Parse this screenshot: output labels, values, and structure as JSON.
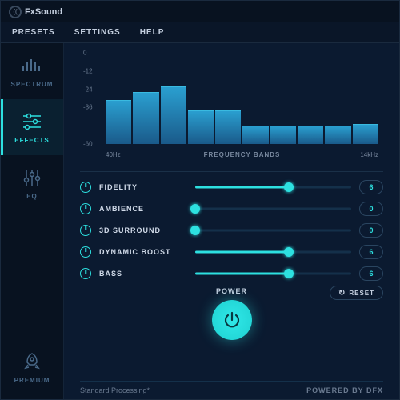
{
  "app": {
    "name": "FxSound",
    "logo_glyph": "(("
  },
  "menu": {
    "presets": "PRESETS",
    "settings": "SETTINGS",
    "help": "HELP"
  },
  "sidebar": {
    "items": [
      {
        "id": "spectrum",
        "label": "SPECTRUM"
      },
      {
        "id": "effects",
        "label": "EFFECTS"
      },
      {
        "id": "eq",
        "label": "EQ"
      },
      {
        "id": "premium",
        "label": "PREMIUM"
      }
    ]
  },
  "chart_data": {
    "type": "bar",
    "categories": [
      "40Hz",
      "",
      "",
      "",
      "",
      "",
      "",
      "",
      "",
      "14kHz"
    ],
    "values": [
      -31,
      -26,
      -22,
      -38,
      -38,
      -48,
      -48,
      -48,
      -48,
      -47
    ],
    "ylim": [
      -60,
      0
    ],
    "yticks": [
      0,
      -12,
      -24,
      -36,
      -60
    ],
    "xlabel": "FREQUENCY BANDS",
    "ylabel": "",
    "title": ""
  },
  "effects": [
    {
      "name": "FIDELITY",
      "value": 6,
      "display": "6"
    },
    {
      "name": "AMBIENCE",
      "value": 0,
      "display": "0"
    },
    {
      "name": "3D SURROUND",
      "value": 0,
      "display": "0"
    },
    {
      "name": "DYNAMIC BOOST",
      "value": 6,
      "display": "6"
    },
    {
      "name": "BASS",
      "value": 6,
      "display": "6"
    }
  ],
  "effects_max": 10,
  "power": {
    "label": "POWER",
    "reset": "RESET"
  },
  "footer": {
    "left": "Standard Processing*",
    "right": "POWERED BY DFX"
  }
}
